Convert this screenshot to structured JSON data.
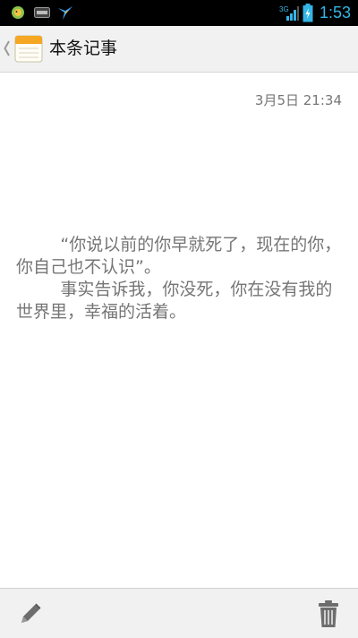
{
  "status_bar": {
    "time": "1:53",
    "network_label": "3G",
    "notification_icons": [
      "android-icon",
      "sta-icon",
      "bird-icon"
    ],
    "accent_color": "#33b5e5"
  },
  "action_bar": {
    "title": "本条记事",
    "back_icon": "chevron-left-icon",
    "app_icon": "notepad-icon"
  },
  "note": {
    "date": "3月5日 21:34",
    "paragraphs": [
      "“你说以前的你早就死了，现在的你，你自己也不认识”。",
      "事实告诉我，你没死，你在没有我的世界里，幸福的活着。"
    ]
  },
  "bottom_bar": {
    "edit_icon": "pencil-icon",
    "delete_icon": "trash-icon"
  }
}
